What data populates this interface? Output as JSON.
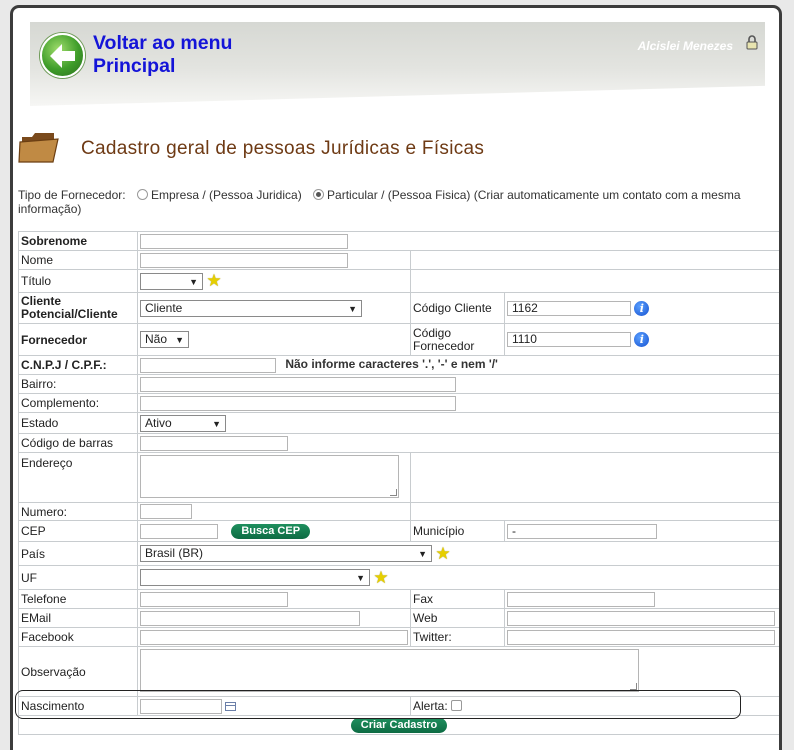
{
  "header": {
    "back_line1": "Voltar ao menu",
    "back_line2": "Principal",
    "user": "Alcislei Menezes"
  },
  "page_title": "Cadastro geral de pessoas Jurídicas e Físicas",
  "tipo_fornecedor": {
    "label": "Tipo de Fornecedor:",
    "option1": "Empresa / (Pessoa Juridica)",
    "option2": "Particular / (Pessoa Fisica) (Criar automaticamente um contato com a mesma informação)",
    "selected": "option2"
  },
  "form": {
    "sobrenome": "Sobrenome",
    "nome": "Nome",
    "titulo": "Título",
    "cliente_label": "Cliente Potencial/Cliente",
    "cliente_value": "Cliente",
    "codigo_cliente_label": "Código Cliente",
    "codigo_cliente_value": "1162",
    "fornecedor_label": "Fornecedor",
    "fornecedor_value": "Não",
    "codigo_fornecedor_label": "Código Fornecedor",
    "codigo_fornecedor_value": "1110",
    "cnpj_label": "C.N.P.J / C.P.F.:",
    "cnpj_hint": "Não informe caracteres '.', '-' e nem '/'",
    "bairro": "Bairro:",
    "complemento": "Complemento:",
    "estado_label": "Estado",
    "estado_value": "Ativo",
    "codigo_barras": "Código de barras",
    "endereco": "Endereço",
    "numero": "Numero:",
    "cep": "CEP",
    "busca_cep": "Busca CEP",
    "municipio_label": "Município",
    "municipio_value": "-",
    "pais_label": "País",
    "pais_value": "Brasil (BR)",
    "uf": "UF",
    "telefone": "Telefone",
    "fax": "Fax",
    "email": "EMail",
    "web": "Web",
    "facebook": "Facebook",
    "twitter": "Twitter:",
    "observacao": "Observação",
    "nascimento": "Nascimento",
    "alerta": "Alerta:",
    "submit": "Criar Cadastro"
  },
  "icons": {
    "back": "back-arrow-icon",
    "lock": "lock-icon",
    "folder": "folder-icon",
    "star": "star-icon",
    "info": "info-icon",
    "calendar": "calendar-icon"
  },
  "colors": {
    "back_title": "#1414d8",
    "page_title": "#6e3a14",
    "button": "#0d6b43",
    "label_bold": "#1c2f6e"
  }
}
